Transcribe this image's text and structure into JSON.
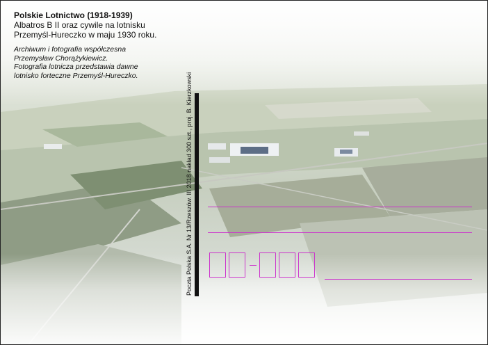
{
  "header": {
    "title": "Polskie Lotnictwo (1918-1939)",
    "subtitle_line1": "Albatros B II oraz cywile na lotnisku",
    "subtitle_line2": "Przemyśl-Hureczko w maju 1930 roku."
  },
  "credits": {
    "line1": "Archiwum i fotografia współczesna",
    "line2": "Przemysław Chorążykiewicz.",
    "line3": "Fotografia lotnicza przedstawia dawne",
    "line4": "lotnisko forteczne Przemyśl-Hureczko."
  },
  "imprint": "Poczta Polska S.A. Nr 13/Rzeszów. III 2018 nakład 300 szt., proj. B. Kierzkowski",
  "colors": {
    "address_lines": "#cc33cc",
    "divider": "#111111"
  }
}
